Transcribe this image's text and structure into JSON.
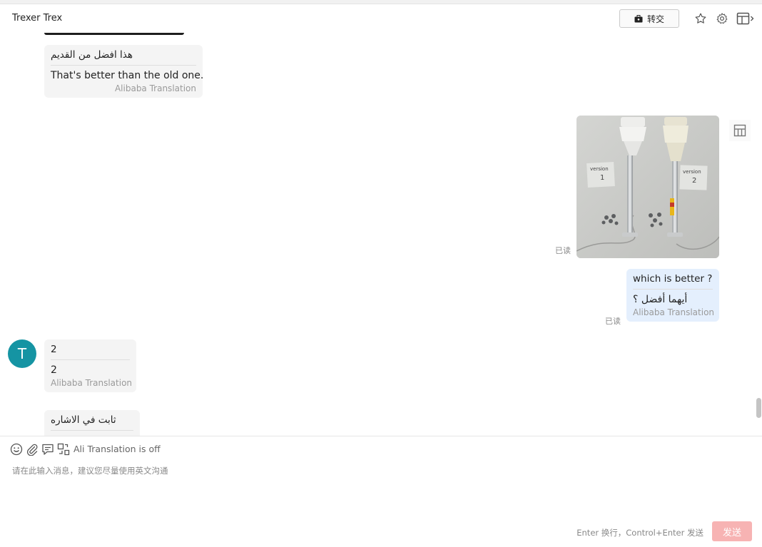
{
  "header": {
    "contact_name": "Trexer Trex",
    "transfer_label": "转交",
    "icons": [
      "briefcase-icon",
      "star-icon",
      "settings-icon",
      "panel-toggle-icon"
    ]
  },
  "messages": [
    {
      "sender": "contact",
      "original": "هذا افضل من القديم",
      "translation": "That's better than the old one.",
      "source": "Alibaba Translation"
    },
    {
      "sender": "me",
      "type": "image",
      "image_labels": [
        "version",
        "1",
        "version",
        "2"
      ],
      "read_status": "已读"
    },
    {
      "sender": "me",
      "original": "which is better ?",
      "translation": "أيهما أفضل ؟",
      "source": "Alibaba Translation",
      "read_status": "已读"
    },
    {
      "sender": "contact",
      "avatar_letter": "T",
      "original": "2",
      "translation": "2",
      "source": "Alibaba Translation"
    },
    {
      "sender": "contact",
      "original": "ثابت في الاشاره"
    }
  ],
  "toolbar": {
    "translation_status": "Ali Translation is off",
    "icons": [
      "emoji-icon",
      "attachment-icon",
      "quick-reply-icon",
      "translate-icon"
    ]
  },
  "composer": {
    "placeholder": "请在此输入消息，建议您尽量使用英文沟通",
    "hint": "Enter 换行，Control+Enter 发送",
    "send_label": "发送"
  },
  "colors": {
    "avatar": "#1594a3",
    "my_bubble": "#e4effd",
    "their_bubble": "#f4f4f4",
    "send_button": "#f7b3b3"
  }
}
